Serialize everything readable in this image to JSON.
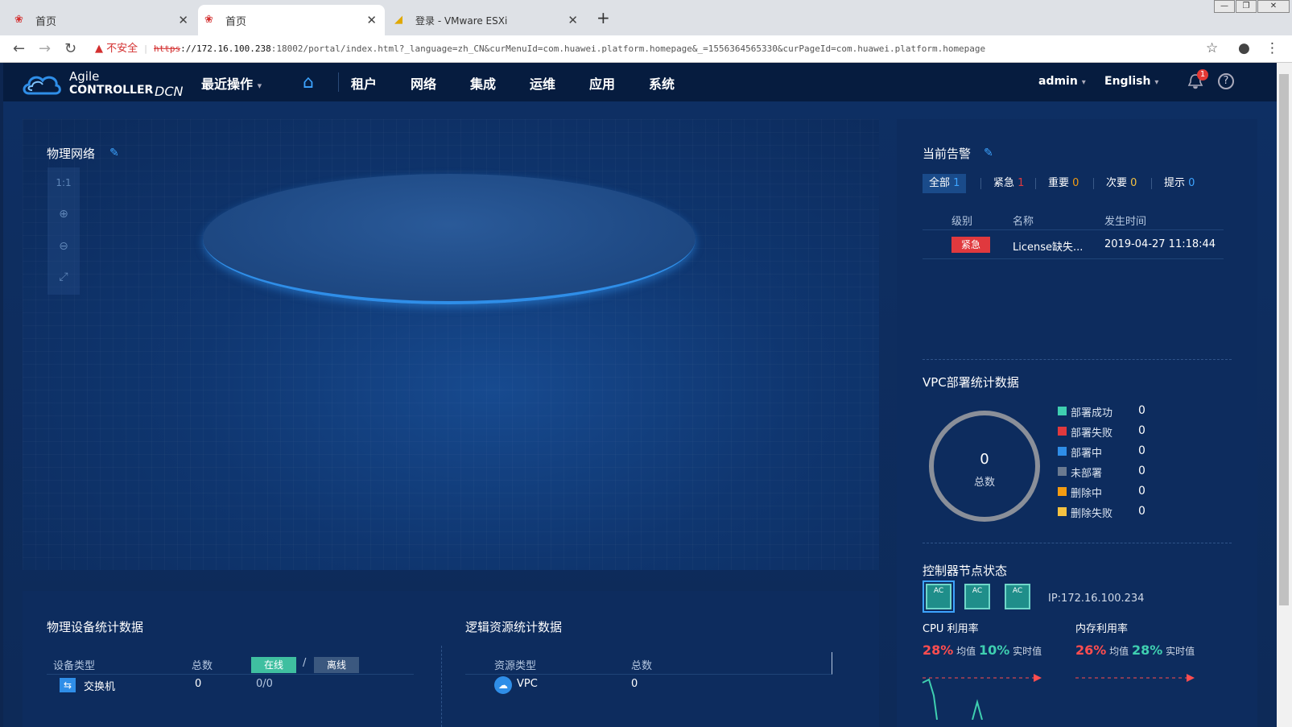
{
  "browser": {
    "tabs": [
      {
        "title": "首页"
      },
      {
        "title": "首页"
      },
      {
        "title": "登录 - VMware ESXi"
      }
    ],
    "security_label": "不安全",
    "url_scheme": "https",
    "url_host": "://172.16.100.238",
    "url_rest": ":18002/portal/index.html?_language=zh_CN&curMenuId=com.huawei.platform.homepage&_=1556364565330&curPageId=com.huawei.platform.homepage"
  },
  "app": {
    "logo_line1": "Agile",
    "logo_line2": "CONTROLLER",
    "logo_line3": "DCN",
    "menu": {
      "recent": "最近操作",
      "tenant": "租户",
      "network": "网络",
      "integration": "集成",
      "ops": "运维",
      "apps": "应用",
      "system": "系统"
    },
    "user": "admin",
    "language": "English",
    "notification_count": "1",
    "help_glyph": "?"
  },
  "topology": {
    "title": "物理网络",
    "ratio": "1:1"
  },
  "alarms": {
    "title": "当前告警",
    "filters": [
      {
        "label": "全部",
        "count": "1",
        "color": "#3da4ff"
      },
      {
        "label": "紧急",
        "count": "1",
        "color": "#e0393e"
      },
      {
        "label": "重要",
        "count": "0",
        "color": "#f39c12"
      },
      {
        "label": "次要",
        "count": "0",
        "color": "#f5c242"
      },
      {
        "label": "提示",
        "count": "0",
        "color": "#3da4ff"
      }
    ],
    "columns": {
      "level": "级别",
      "name": "名称",
      "time": "发生时间"
    },
    "rows": [
      {
        "level": "紧急",
        "name": "License缺失...",
        "time": "2019-04-27 11:18:44"
      }
    ]
  },
  "vpc": {
    "title": "VPC部署统计数据",
    "total_value": "0",
    "total_label": "总数",
    "legend": [
      {
        "label": "部署成功",
        "value": "0",
        "color": "#3fcfb0"
      },
      {
        "label": "部署失败",
        "value": "0",
        "color": "#e0393e"
      },
      {
        "label": "部署中",
        "value": "0",
        "color": "#2f8ee8"
      },
      {
        "label": "未部署",
        "value": "0",
        "color": "#6b7a90"
      },
      {
        "label": "删除中",
        "value": "0",
        "color": "#f39c12"
      },
      {
        "label": "删除失败",
        "value": "0",
        "color": "#f5c242"
      }
    ]
  },
  "controller": {
    "title": "控制器节点状态",
    "node_label": "AC",
    "ip": "IP:172.16.100.234",
    "cpu_title": "CPU 利用率",
    "cpu_avg": "28%",
    "cpu_now": "10%",
    "mem_title": "内存利用率",
    "mem_avg": "26%",
    "mem_now": "28%",
    "avg_label": "均值",
    "now_label": "实时值"
  },
  "physical_stats": {
    "title": "物理设备统计数据",
    "col_type": "设备类型",
    "col_total": "总数",
    "online": "在线",
    "slash": "/",
    "offline": "离线",
    "row_name": "交换机",
    "row_total": "0",
    "row_ratio": "0/0"
  },
  "logical_stats": {
    "title": "逻辑资源统计数据",
    "col_type": "资源类型",
    "col_total": "总数",
    "row_name": "VPC",
    "row_total": "0"
  }
}
